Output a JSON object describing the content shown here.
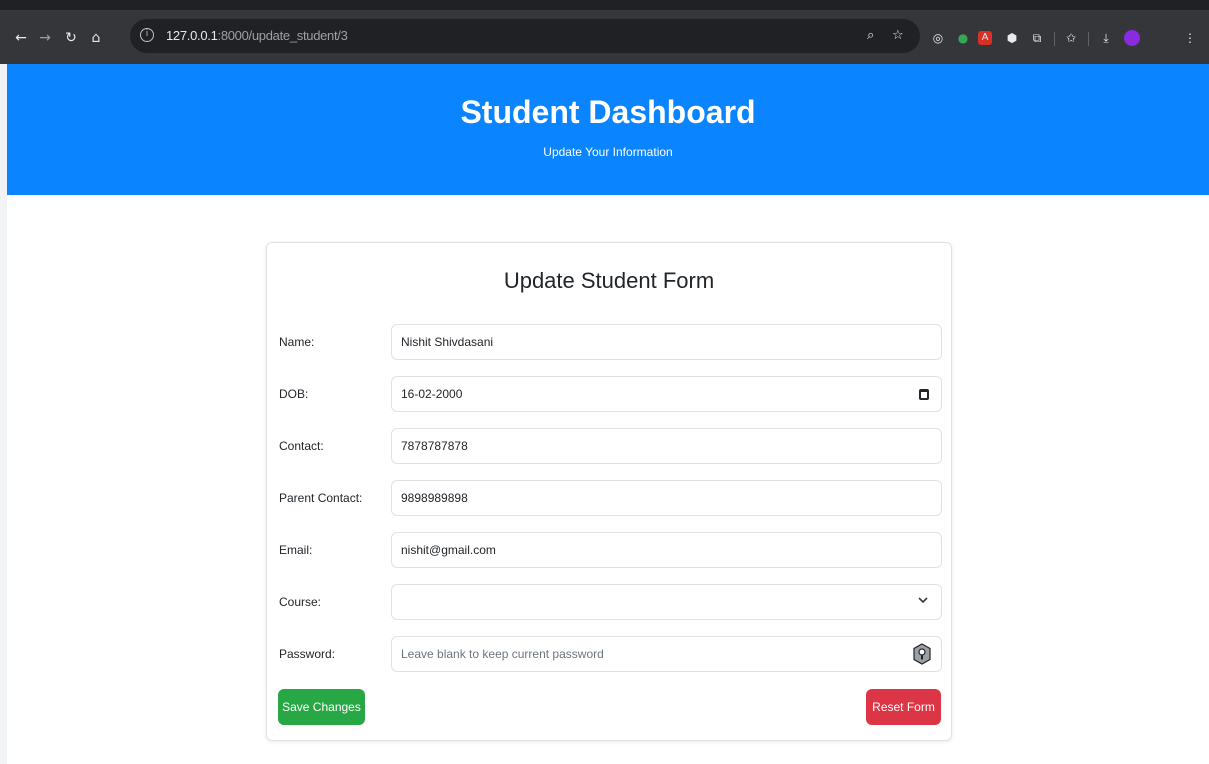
{
  "browser": {
    "url_host": "127.0.0.1",
    "url_rest": ":8000/update_student/3"
  },
  "header": {
    "title": "Student Dashboard",
    "subtitle": "Update Your Information"
  },
  "form": {
    "title": "Update Student Form",
    "fields": [
      {
        "label": "Name:",
        "value": "Nishit Shivdasani"
      },
      {
        "label": "DOB:",
        "value": "16-02-2000"
      },
      {
        "label": "Contact:",
        "value": "7878787878"
      },
      {
        "label": "Parent Contact:",
        "value": "9898989898"
      },
      {
        "label": "Email:",
        "value": "nishit@gmail.com"
      },
      {
        "label": "Course:",
        "value": ""
      },
      {
        "label": "Password:",
        "value": "",
        "placeholder": "Leave blank to keep current password"
      }
    ],
    "save_label": "Save Changes",
    "reset_label": "Reset Form"
  },
  "colors": {
    "header_bg": "#0a84ff",
    "save_button": "#28a745",
    "reset_button": "#dc3545"
  }
}
